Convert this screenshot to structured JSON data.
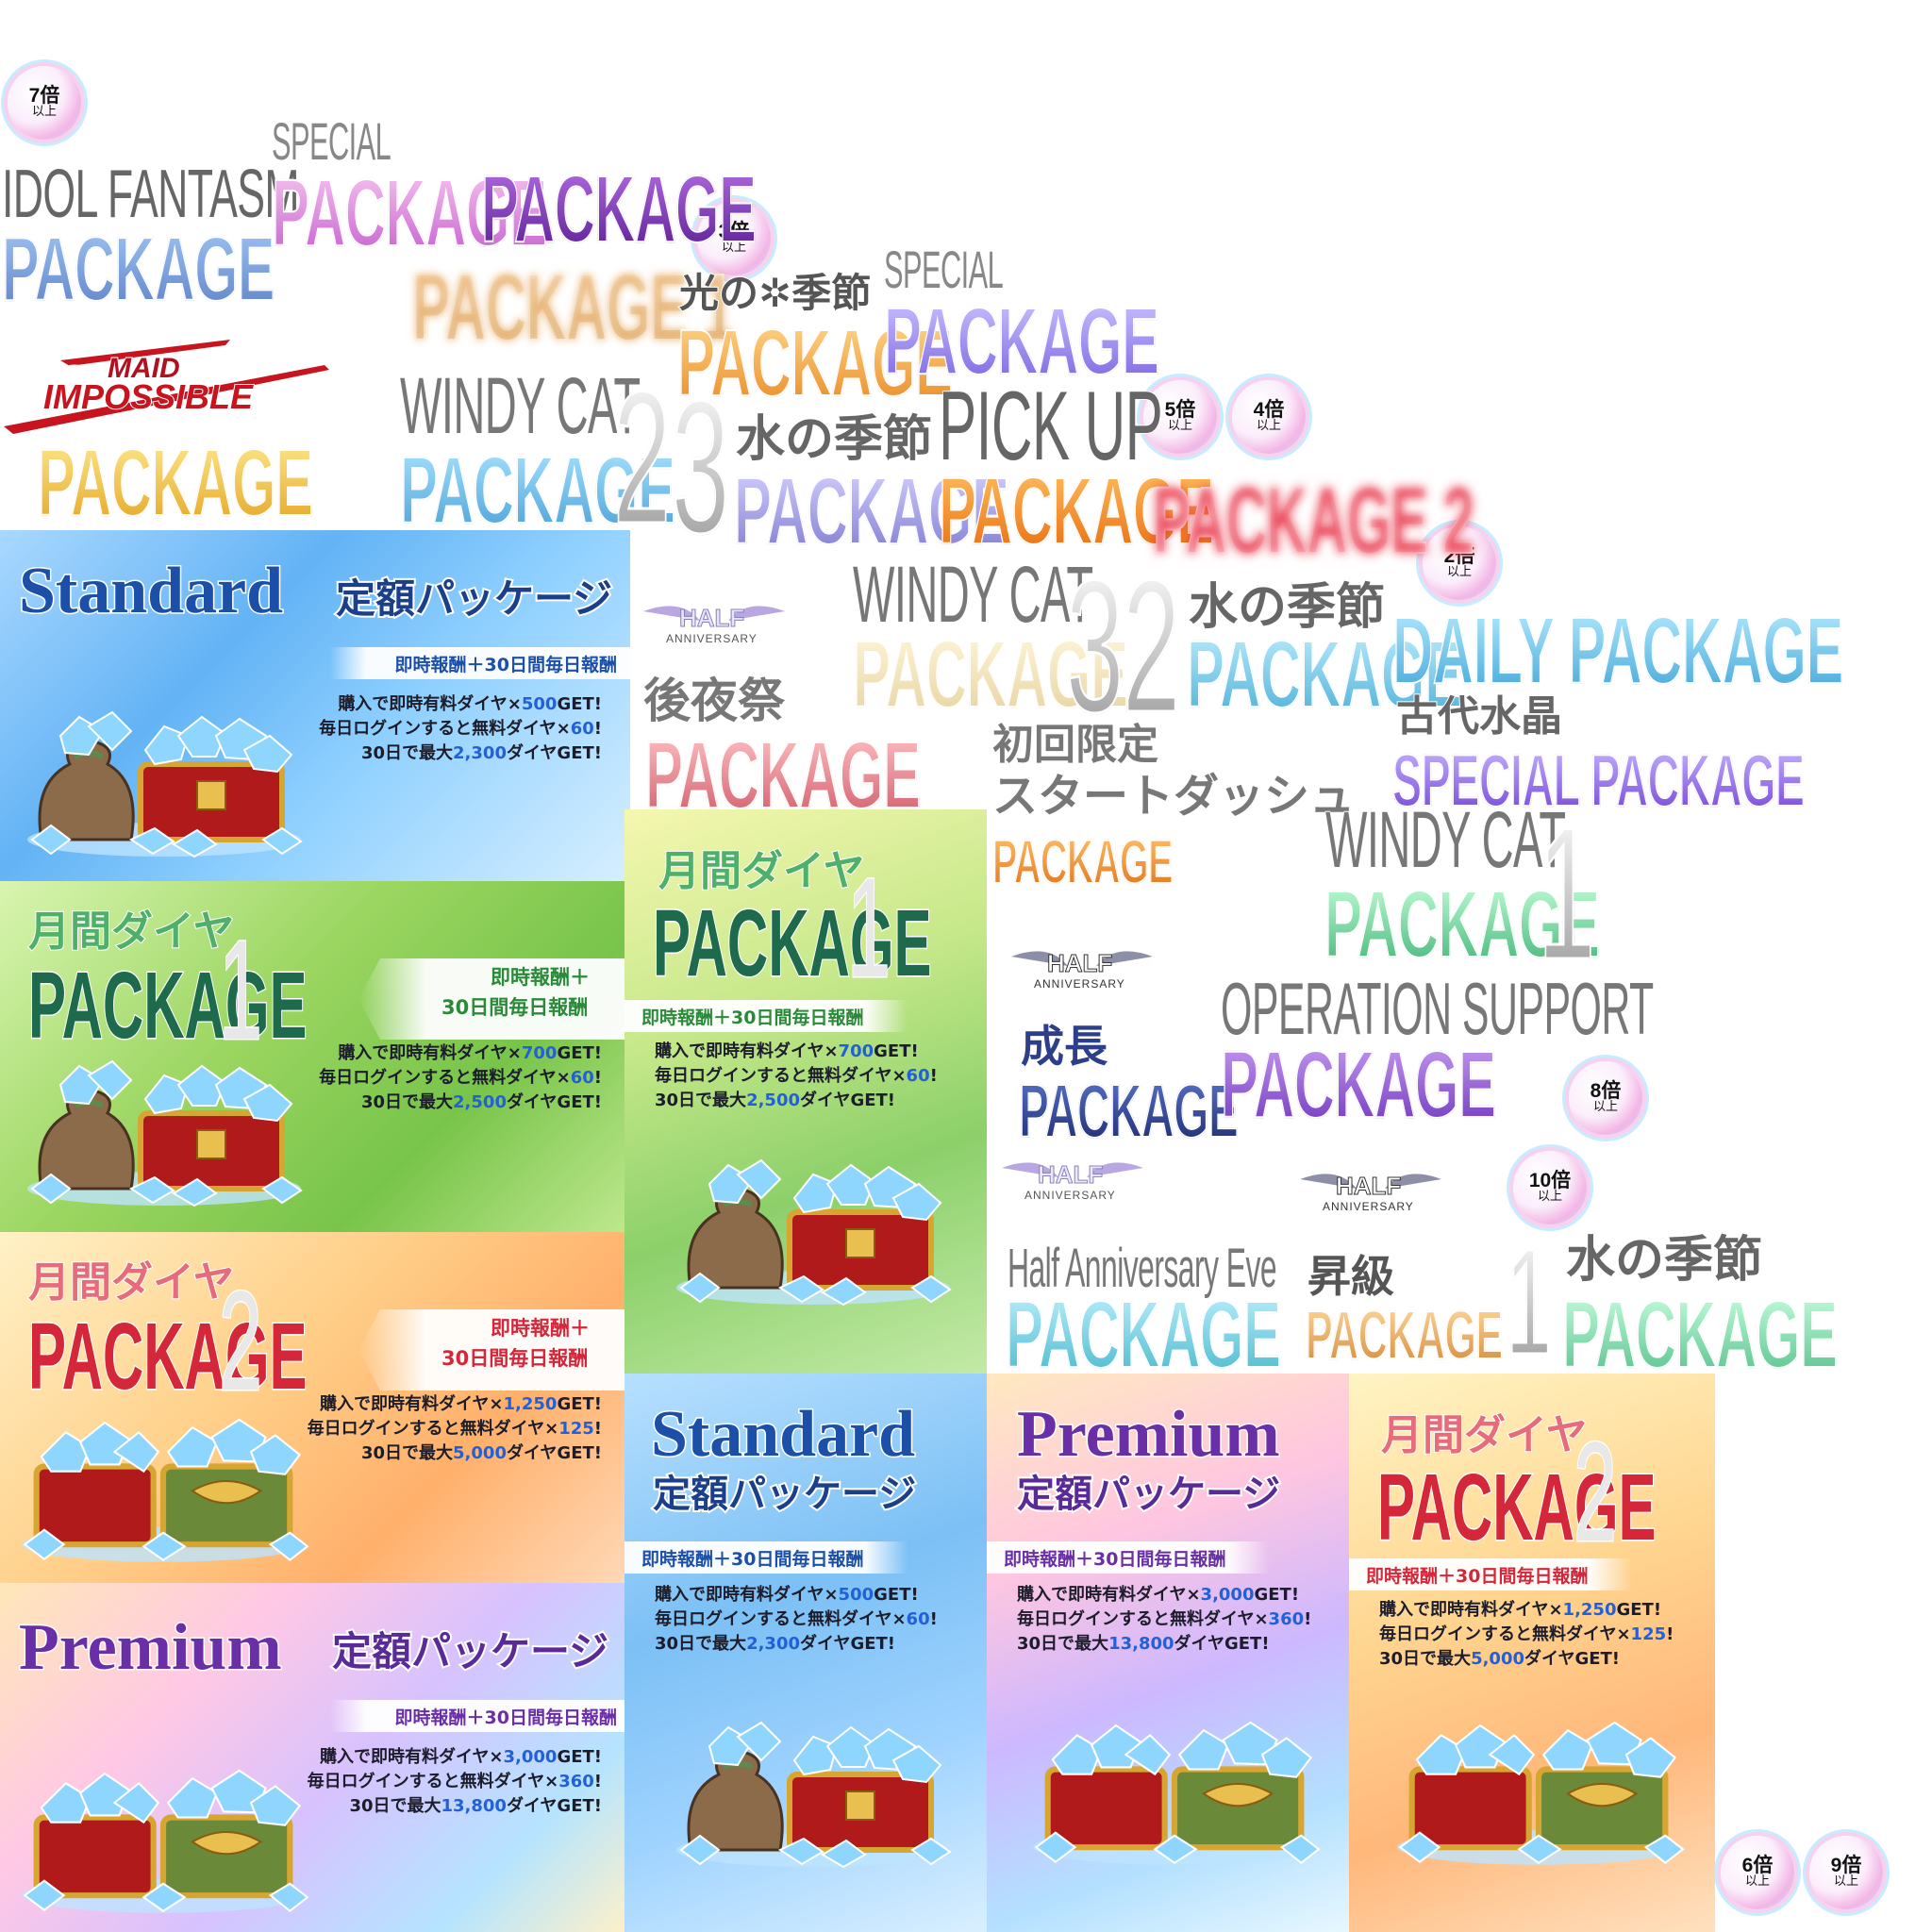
{
  "badges": [
    {
      "top": "7倍",
      "bottom": "以上"
    },
    {
      "top": "3倍",
      "bottom": "以上"
    },
    {
      "top": "5倍",
      "bottom": "以上"
    },
    {
      "top": "4倍",
      "bottom": "以上"
    },
    {
      "top": "2倍",
      "bottom": "以上"
    },
    {
      "top": "8倍",
      "bottom": "以上"
    },
    {
      "top": "10倍",
      "bottom": "以上"
    },
    {
      "top": "6倍",
      "bottom": "以上"
    },
    {
      "top": "9倍",
      "bottom": "以上"
    }
  ],
  "titles": {
    "idol_line1": "IDOL FANTASM",
    "idol_line2": "PACKAGE",
    "special_small_1": "SPECIAL",
    "special_pkg_pink": "PACKAGE",
    "pkg_purple": "PACKAGE",
    "package_1": "PACKAGE 1",
    "hikari": "光の✲季節",
    "hikari_pkg": "PACKAGE",
    "special_small_2": "SPECIAL",
    "special_pkg_violet": "PACKAGE",
    "maid_logo_1": "MAID",
    "maid_logo_2": "IMPOSSIBLE",
    "maid_pkg": "PACKAGE",
    "windy_cat_1": "WINDY CAT",
    "windy_pkg_1": "PACKAGE",
    "windy_num_1": "2",
    "mizu_num_1": "3",
    "mizu_1": "水の季節",
    "mizu_pkg_1": "PACKAGE",
    "pickup": "PICK UP",
    "pickup_pkg": "PACKAGE",
    "package_2": "PACKAGE 2",
    "half_logo": "HALF",
    "half_logo_sub": "ANNIVERSARY",
    "koyasai": "後夜祭",
    "koyasai_pkg": "PACKAGE",
    "windy_cat_2": "WINDY CAT",
    "windy_pkg_2": "PACKAGE",
    "windy_num_2": "3",
    "mizu_num_2": "2",
    "mizu_2": "水の季節",
    "mizu_pkg_2": "PACKAGE",
    "daily": "DAILY PACKAGE",
    "kodai": "古代水晶",
    "special_pkg": "SPECIAL PACKAGE",
    "shokai_1": "初回限定",
    "shokai_2": "スタートダッシュ",
    "shokai_pkg": "PACKAGE",
    "windy_cat_3": "WINDY CAT",
    "windy_pkg_3": "PACKAGE",
    "windy_num_3": "1",
    "seicho": "成長",
    "seicho_pkg": "PACKAGE",
    "operation": "OPERATION SUPPORT",
    "operation_pkg": "PACKAGE",
    "half_eve": "Half Anniversary Eve",
    "half_eve_pkg": "PACKAGE",
    "shokyu": "昇級",
    "shokyu_pkg": "PACKAGE",
    "mizu_num_3": "1",
    "mizu_3": "水の季節",
    "mizu_pkg_3": "PACKAGE"
  },
  "banners": {
    "standard_wide": {
      "brand": "Standard",
      "sub": "定額パッケージ",
      "ribbon": "即時報酬＋30日間毎日報酬",
      "l1": "購入で即時有料ダイヤ×500GET!",
      "l2": "毎日ログインすると無料ダイヤ×60!",
      "l3": "30日で最大2,300ダイヤGET!"
    },
    "monthly1_wide": {
      "jp": "月間ダイヤ",
      "pkg": "PACKAGE",
      "num": "1",
      "rib1": "即時報酬＋",
      "rib2": "30日間毎日報酬",
      "l1": "購入で即時有料ダイヤ×700GET!",
      "l2": "毎日ログインすると無料ダイヤ×60!",
      "l3": "30日で最大2,500ダイヤGET!"
    },
    "monthly2_wide": {
      "jp": "月間ダイヤ",
      "pkg": "PACKAGE",
      "num": "2",
      "rib1": "即時報酬＋",
      "rib2": "30日間毎日報酬",
      "l1": "購入で即時有料ダイヤ×1,250GET!",
      "l2": "毎日ログインすると無料ダイヤ×125!",
      "l3": "30日で最大5,000ダイヤGET!"
    },
    "premium_wide": {
      "brand": "Premium",
      "sub": "定額パッケージ",
      "ribbon": "即時報酬＋30日間毎日報酬",
      "l1": "購入で即時有料ダイヤ×3,000GET!",
      "l2": "毎日ログインすると無料ダイヤ×360!",
      "l3": "30日で最大13,800ダイヤGET!"
    },
    "monthly1_tall": {
      "jp": "月間ダイヤ",
      "pkg": "PACKAGE",
      "num": "1",
      "ribbon": "即時報酬＋30日間毎日報酬",
      "l1": "購入で即時有料ダイヤ×700GET!",
      "l2": "毎日ログインすると無料ダイヤ×60!",
      "l3": "30日で最大2,500ダイヤGET!"
    },
    "standard_tall": {
      "brand": "Standard",
      "sub": "定額パッケージ",
      "ribbon": "即時報酬＋30日間毎日報酬",
      "l1": "購入で即時有料ダイヤ×500GET!",
      "l2": "毎日ログインすると無料ダイヤ×60!",
      "l3": "30日で最大2,300ダイヤGET!"
    },
    "premium_tall": {
      "brand": "Premium",
      "sub": "定額パッケージ",
      "ribbon": "即時報酬＋30日間毎日報酬",
      "l1": "購入で即時有料ダイヤ×3,000GET!",
      "l2": "毎日ログインすると無料ダイヤ×360!",
      "l3": "30日で最大13,800ダイヤGET!"
    },
    "monthly2_tall": {
      "jp": "月間ダイヤ",
      "pkg": "PACKAGE",
      "num": "2",
      "ribbon": "即時報酬＋30日間毎日報酬",
      "l1": "購入で即時有料ダイヤ×1,250GET!",
      "l2": "毎日ログインすると無料ダイヤ×125!",
      "l3": "30日で最大5,000ダイヤGET!"
    }
  },
  "colors": {
    "standard_blue": "#1c4fa8",
    "premium_purple": "#6a2fa6",
    "monthly_green": "#1d6b4c",
    "monthly_red": "#d4273a"
  }
}
